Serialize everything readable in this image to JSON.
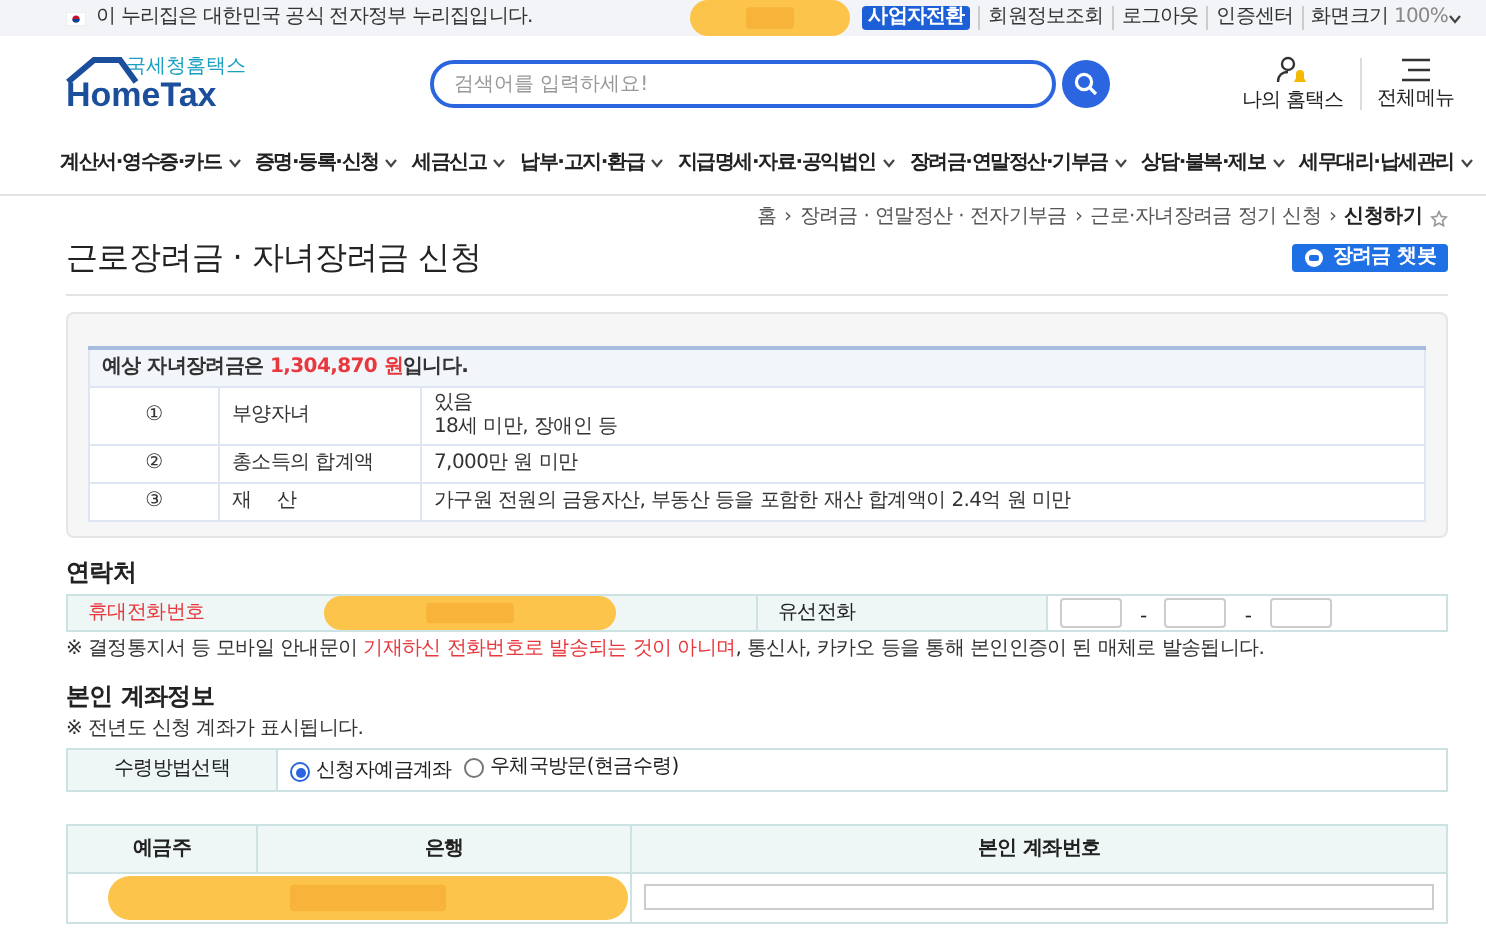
{
  "gov_bar": {
    "notice": "이 누리집은 대한민국 공식 전자정부 누리집입니다.",
    "business_switch": "사업자전환",
    "links": [
      "회원정보조회",
      "로그아웃",
      "인증센터"
    ],
    "zoom_label": "화면크기",
    "zoom_value": "100%"
  },
  "header": {
    "logo_subtitle": "국세청홈택스",
    "logo": "HomeTax",
    "search": {
      "placeholder": "검색어를 입력하세요!"
    },
    "my_hometax": "나의 홈택스",
    "all_menu": "전체메뉴"
  },
  "nav": [
    "계산서·영수증·카드",
    "증명·등록·신청",
    "세금신고",
    "납부·고지·환급",
    "지급명세·자료·공익법인",
    "장려금·연말정산·기부금",
    "상담·불복·제보",
    "세무대리·납세관리"
  ],
  "breadcrumb": [
    "홈",
    "장려금 · 연말정산 · 전자기부금",
    "근로·자녀장려금 정기 신청",
    "신청하기"
  ],
  "breadcrumb_separators": [
    "›",
    "›",
    "›"
  ],
  "title": "근로장려금 · 자녀장려금 신청",
  "chatbot_button": "장려금 챗봇",
  "summary": {
    "text": "예상 자녀장려금은 **1,304,870 원**입니다.",
    "rows": [
      {
        "number": "①",
        "label": "부양자녀",
        "value": [
          "있음",
          "18세 미만, 장애인 등"
        ]
      },
      {
        "number": "②",
        "label": "총소득의 합계액",
        "value": [
          "7,000만 원 미만"
        ]
      },
      {
        "number": "③",
        "label": "재　 산",
        "value": [
          "가구원 전원의 금융자산, 부동산 등을 포함한 재산 합계액이 2.4억 원 미만"
        ]
      }
    ]
  },
  "contact": {
    "heading": "연락처",
    "mobile_label": "휴대전화번호",
    "landline_label": "유선전화",
    "separators": [
      "-",
      "-"
    ],
    "note": [
      {
        "text": "※ 결정통지서 등 모바일 안내문이 ",
        "highlight": false
      },
      {
        "text": "기재하신 전화번호로 발송되는 것이 아니며",
        "highlight": true
      },
      {
        "text": ", 통신사, 카카오 등을 통해 본인인증이 된 매체로 발송됩니다.",
        "highlight": false
      }
    ]
  },
  "account": {
    "heading": "본인 계좌정보",
    "note": "※ 전년도 신청 계좌가 표시됩니다.",
    "method_label": "수령방법선택",
    "options": [
      {
        "label": "신청자예금계좌",
        "selected": true
      },
      {
        "label": "우체국방문(현금수령)",
        "selected": false
      }
    ],
    "columns": [
      "예금주",
      "은행",
      "본인 계좌번호"
    ]
  }
}
